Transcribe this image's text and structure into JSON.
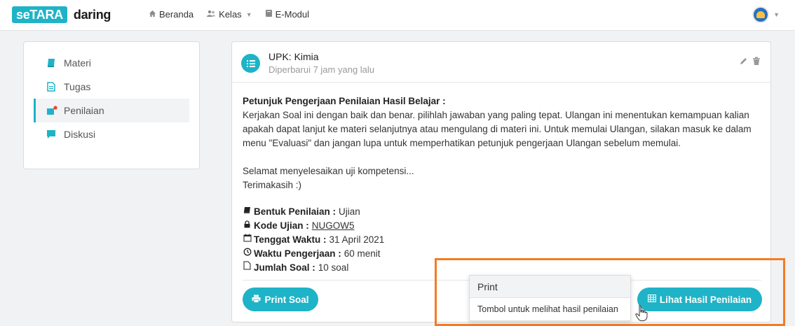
{
  "header": {
    "logo_badge": "seTARA",
    "logo_text": "daring",
    "nav": [
      {
        "label": "Beranda",
        "icon": "home-icon"
      },
      {
        "label": "Kelas",
        "icon": "users-icon"
      },
      {
        "label": "E-Modul",
        "icon": "book-icon"
      }
    ]
  },
  "sidebar": {
    "items": [
      {
        "label": "Materi",
        "icon": "book-icon"
      },
      {
        "label": "Tugas",
        "icon": "file-icon"
      },
      {
        "label": "Penilaian",
        "icon": "grade-icon",
        "active": true
      },
      {
        "label": "Diskusi",
        "icon": "chat-icon"
      }
    ]
  },
  "card": {
    "title": "UPK: Kimia",
    "updated": "Diperbarui 7 jam yang lalu",
    "instruction_heading": "Petunjuk Pengerjaan Penilaian Hasil Belajar :",
    "instruction_body": "Kerjakan Soal ini dengan baik dan benar. pilihlah jawaban yang paling tepat. Ulangan ini menentukan kemampuan kalian apakah dapat lanjut ke materi selanjutnya atau mengulang di materi ini. Untuk memulai Ulangan, silakan masuk ke dalam menu \"Evaluasi\" dan jangan lupa untuk memperhatikan petunjuk pengerjaan Ulangan sebelum memulai.",
    "closing_1": "Selamat menyelesaikan uji kompetensi...",
    "closing_2": "Terimakasih :)",
    "meta": [
      {
        "label": "Bentuk Penilaian :",
        "value": "Ujian",
        "icon": "book-icon"
      },
      {
        "label": "Kode Ujian :",
        "value": "NUGOW5",
        "icon": "lock-icon"
      },
      {
        "label": "Tenggat Waktu :",
        "value": "31 April 2021",
        "icon": "calendar-icon"
      },
      {
        "label": "Waktu Pengerjaan :",
        "value": "60 menit",
        "icon": "clock-icon"
      },
      {
        "label": "Jumlah Soal :",
        "value": "10 soal",
        "icon": "file-icon"
      }
    ],
    "print_button": "Print Soal",
    "lihat_button": "Lihat Hasil Penilaian"
  },
  "popover": {
    "title": "Print",
    "body": "Tombol untuk melihat hasil penilaian"
  },
  "colors": {
    "accent": "#1fb3c7",
    "highlight": "#f47b25",
    "grade_dot": "#e8452c"
  }
}
